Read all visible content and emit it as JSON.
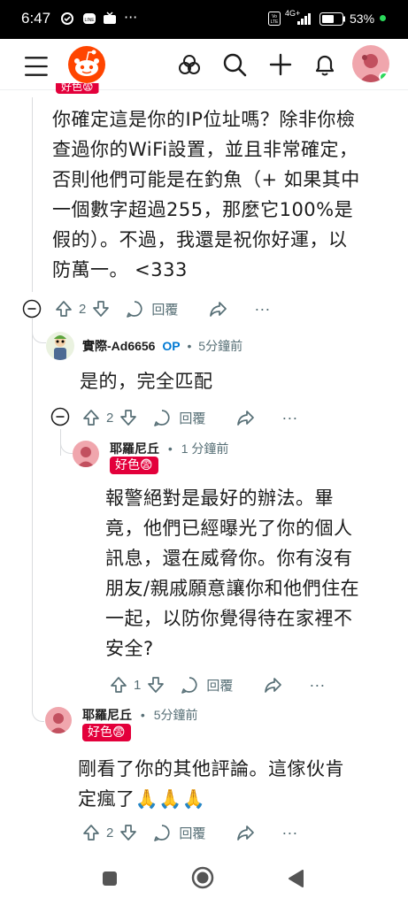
{
  "status_bar": {
    "time": "6:47",
    "battery_percent": "53%",
    "network": "4G+",
    "volte": "Vo LTE"
  },
  "header": {
    "menu_icon": "hamburger-icon",
    "logo_icon": "reddit-logo",
    "icons": [
      "communities-icon",
      "search-icon",
      "create-icon",
      "notifications-icon",
      "avatar"
    ]
  },
  "comments": [
    {
      "id": "c1",
      "flair": "好色😨",
      "body": "你確定這是你的IP位址嗎？除非你檢查過你的WiFi設置，並且非常確定，否則他們可能是在釣魚（+ 如果其中一個數字超過255，那麼它100%是假的）。不過，我還是祝你好運，以防萬一。 <333",
      "body_lines": [
        "你確定這是你的IP位址嗎？除非你檢",
        "查過你的WiFi設置，並且非常確定，",
        "否則他們可能是在釣魚（+ 如果其中",
        "一個數字超過255，那麼它100%是",
        "假的）。不過，我還是祝你好運，以",
        "防萬一。 <333"
      ],
      "votes": "2",
      "reply_label": "回覆"
    },
    {
      "id": "c2",
      "author": "實際-Ad6656",
      "op_badge": "OP",
      "separator": "•",
      "time": "5分鐘前",
      "body": "是的，完全匹配",
      "votes": "2",
      "reply_label": "回覆"
    },
    {
      "id": "c3",
      "author": "耶羅尼丘",
      "separator": "•",
      "time": "1 分鐘前",
      "flair": "好色😨",
      "body_lines": [
        "報警絕對是最好的辦法。畢",
        "竟，他們已經曝光了你的個人",
        "訊息，還在威脅你。你有沒有",
        "朋友/親戚願意讓你和他們住在",
        "一起，以防你覺得待在家裡不",
        "安全?"
      ],
      "votes": "1",
      "reply_label": "回覆"
    },
    {
      "id": "c4",
      "author": "耶羅尼丘",
      "separator": "•",
      "time": "5分鐘前",
      "flair": "好色😨",
      "body_lines": [
        "剛看了你的其他評論。這傢伙肯",
        "定瘋了🙏🙏🙏"
      ],
      "votes": "2",
      "reply_label": "回覆"
    }
  ],
  "colors": {
    "reddit_orange": "#ff4500",
    "flair_red": "#e3003b",
    "op_blue": "#0079d3",
    "meta_gray": "#576f76",
    "thread_line": "#d9dbde"
  }
}
